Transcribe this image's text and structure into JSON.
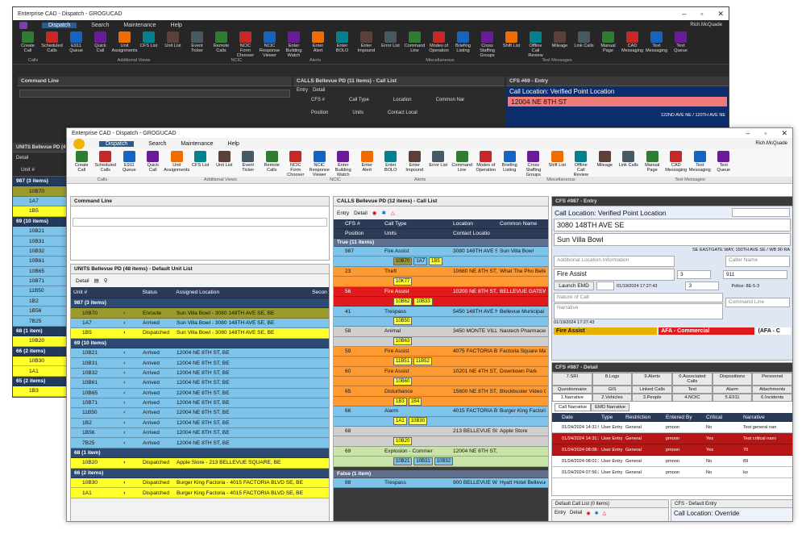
{
  "back_window": {
    "title": "Enterprise CAD - Dispatch - GROGUCAD",
    "user": "Rich.McQuade",
    "menu": [
      "Dispatch",
      "Search",
      "Maintenance",
      "Help"
    ],
    "ribbon": [
      "Create Call",
      "Scheduled Calls",
      "E911 Queue",
      "Quick Call",
      "Unit Assignments",
      "CFS List",
      "Unit List",
      "Event Ticker",
      "Remote Calls",
      "NCIC Form Chooser",
      "NCIC Response Viewer",
      "Enter Building Watch",
      "Enter Alert",
      "Enter BOLO",
      "Enter Impound",
      "Error List",
      "Command Line",
      "Modes of Operation",
      "Briefing Listing",
      "Cross Staffing Groups",
      "Shift List",
      "Offline Call Review",
      "Mileage",
      "Link Calls",
      "Manual Page",
      "CAD Messaging",
      "Text Messaging",
      "Text Queue"
    ],
    "groups": [
      "Calls",
      "Additional Views",
      "NCIC",
      "Alerts",
      "Miscellaneous",
      "Text Messages"
    ],
    "command_line": "Command Line",
    "calls_title": "CALLS Bellevue PD (11 items) - Call List",
    "calls_toolbar": [
      "Entry",
      "Detail"
    ],
    "calls_cols": [
      "CFS #",
      "Call Type",
      "Location",
      "Common Nar"
    ],
    "calls_cols2": [
      "Position",
      "Units",
      "Contact Local"
    ],
    "cfs_title": "CFS #69 - Entry",
    "call_location": "Call Location:  Verified Point Location",
    "address": "12004 NE 8TH ST",
    "cross": "122ND AVE NE / 120TH AVE NE",
    "units_title": "UNITS Bellevue PD (4",
    "units_toolbar": "Detail",
    "unit_col": "Unit #",
    "groups_list": [
      {
        "label": "987 (3 items)",
        "units": [
          {
            "id": "10B70",
            "c": "olive"
          },
          {
            "id": "1A7",
            "c": "blue"
          },
          {
            "id": "1B5",
            "c": "yellow"
          }
        ]
      },
      {
        "label": "69 (10 items)",
        "units": [
          {
            "id": "10B21",
            "c": "blue"
          },
          {
            "id": "10B31",
            "c": "blue"
          },
          {
            "id": "10B32",
            "c": "blue"
          },
          {
            "id": "10B61",
            "c": "blue"
          },
          {
            "id": "10B65",
            "c": "blue"
          },
          {
            "id": "10B71",
            "c": "blue"
          },
          {
            "id": "11B50",
            "c": "blue"
          },
          {
            "id": "1B2",
            "c": "blue"
          },
          {
            "id": "1B56",
            "c": "blue"
          },
          {
            "id": "7B25",
            "c": "blue"
          }
        ]
      },
      {
        "label": "68 (1 item)",
        "units": [
          {
            "id": "10B20",
            "c": "yellow"
          }
        ]
      },
      {
        "label": "66 (2 items)",
        "units": [
          {
            "id": "10B30",
            "c": "yellow"
          },
          {
            "id": "1A1",
            "c": "yellow"
          }
        ]
      },
      {
        "label": "65 (2 items)",
        "units": [
          {
            "id": "1B3",
            "c": "yellow"
          }
        ]
      }
    ]
  },
  "front_window": {
    "title": "Enterprise CAD - Dispatch - GROGUCAD",
    "user": "Rich.McQuade",
    "menu": [
      "Dispatch",
      "Search",
      "Maintenance",
      "Help"
    ],
    "command_line": "Command Line",
    "units_title": "UNITS Bellevue PD (48 items) - Default Unit List",
    "units_toolbar": "Detail",
    "units_cols": [
      "Unit #",
      "Status",
      "Assigned Location",
      "Secon"
    ],
    "units_groups": [
      {
        "label": "987 (3 items)",
        "rows": [
          {
            "unit": "10B70",
            "status": "Enroute",
            "loc": "Sun Villa Bowl - 3080 148TH AVE SE, BE",
            "c": "olive"
          },
          {
            "unit": "1A7",
            "status": "Arrived",
            "loc": "Sun Villa Bowl - 3080 148TH AVE SE, BE",
            "c": "blue"
          },
          {
            "unit": "1B5",
            "status": "Dispatched",
            "loc": "Sun Villa Bowl - 3080 148TH AVE SE, BE",
            "c": "yellow"
          }
        ]
      },
      {
        "label": "69 (10 items)",
        "rows": [
          {
            "unit": "10B21",
            "status": "Arrived",
            "loc": "12004 NE 8TH ST, BE",
            "c": "blue"
          },
          {
            "unit": "10B31",
            "status": "Arrived",
            "loc": "12004 NE 8TH ST, BE",
            "c": "blue"
          },
          {
            "unit": "10B32",
            "status": "Arrived",
            "loc": "12004 NE 8TH ST, BE",
            "c": "blue"
          },
          {
            "unit": "10B61",
            "status": "Arrived",
            "loc": "12004 NE 8TH ST, BE",
            "c": "blue"
          },
          {
            "unit": "10B65",
            "status": "Arrived",
            "loc": "12004 NE 8TH ST, BE",
            "c": "blue"
          },
          {
            "unit": "10B71",
            "status": "Arrived",
            "loc": "12004 NE 8TH ST, BE",
            "c": "blue"
          },
          {
            "unit": "11B50",
            "status": "Arrived",
            "loc": "12004 NE 8TH ST, BE",
            "c": "blue"
          },
          {
            "unit": "1B2",
            "status": "Arrived",
            "loc": "12004 NE 8TH ST, BE",
            "c": "blue"
          },
          {
            "unit": "1B56",
            "status": "Arrived",
            "loc": "12004 NE 8TH ST, BE",
            "c": "blue"
          },
          {
            "unit": "7B25",
            "status": "Arrived",
            "loc": "12004 NE 8TH ST, BE",
            "c": "blue"
          }
        ]
      },
      {
        "label": "68 (1 item)",
        "rows": [
          {
            "unit": "10B20",
            "status": "Dispatched",
            "loc": "Apple Store - 213 BELLEVUE SQUARE, BE",
            "c": "yellow"
          }
        ]
      },
      {
        "label": "66 (2 items)",
        "rows": [
          {
            "unit": "10B30",
            "status": "Dispatched",
            "loc": "Burger King Factoria - 4015 FACTORIA BLVD SE, BE",
            "c": "yellow"
          },
          {
            "unit": "1A1",
            "status": "Dispatched",
            "loc": "Burger King Factoria - 4015 FACTORIA BLVD SE, BE",
            "c": "yellow"
          }
        ]
      }
    ],
    "calls_title": "CALLS Bellevue PD (12 items) - Call List",
    "calls_toolbar": [
      "Entry",
      "Detail"
    ],
    "calls_cols": [
      "CFS #",
      "Call Type",
      "Location",
      "Common Name"
    ],
    "calls_cols2": [
      "Position",
      "Units",
      "Contact Locatio"
    ],
    "true_group": "True (11 items)",
    "false_group": "False (1 item)",
    "calls": [
      {
        "cfs": "987",
        "type": "Fire Assist",
        "loc": "3080 148TH AVE SE",
        "name": "Sun Villa Bowl",
        "c": "blue",
        "units": [
          [
            "10B70",
            "olive"
          ],
          [
            "1A7",
            "blue"
          ],
          [
            "1B5",
            "yellow"
          ]
        ]
      },
      {
        "cfs": "23",
        "type": "Theft",
        "loc": "10680 NE 8TH ST, BE",
        "name": "What The Pho Bellev",
        "c": "orange",
        "units": [
          [
            "10K77",
            "yellow"
          ]
        ]
      },
      {
        "cfs": "56",
        "type": "Fire Assist",
        "loc": "10200 NE 8TH ST, BE",
        "name": "BELLEVUE GATEWAY",
        "c": "red",
        "units": [
          [
            "10B62",
            "yellow"
          ],
          [
            "10B33",
            "yellow"
          ]
        ]
      },
      {
        "cfs": "41",
        "type": "Trespass",
        "loc": "5450 148TH AVE NE, BE",
        "name": "Bellevue Municipal C",
        "c": "blue",
        "units": [
          [
            "10B50",
            "yellow"
          ]
        ]
      },
      {
        "cfs": "58",
        "type": "Animal",
        "loc": "3450 MONTE VILLA PKWY",
        "name": "Nastech Pharmaceut",
        "c": "gray",
        "units": [
          [
            "10B63",
            "yellow"
          ]
        ]
      },
      {
        "cfs": "59",
        "type": "Fire Assist",
        "loc": "4075 FACTORIA BLVD SE",
        "name": "Factoria Square Mall",
        "c": "orange",
        "units": [
          [
            "11B51",
            "yellow"
          ],
          [
            "11B52",
            "yellow"
          ]
        ]
      },
      {
        "cfs": "60",
        "type": "Fire Assist",
        "loc": "10201 NE 4TH ST, BE",
        "name": "Downtown Park",
        "c": "orange",
        "units": [
          [
            "10B60",
            "yellow"
          ]
        ]
      },
      {
        "cfs": "65",
        "type": "Disturbance",
        "loc": "15600 NE 8TH ST, BE",
        "name": "Blockbuster Video C",
        "c": "orange",
        "units": [
          [
            "1B3",
            "yellow"
          ],
          [
            "1B4",
            "yellow"
          ]
        ]
      },
      {
        "cfs": "66",
        "type": "Alarm",
        "loc": "4015 FACTORIA BLVD",
        "name": "Burger King Factoria",
        "c": "blue",
        "units": [
          [
            "1A1",
            "yellow"
          ],
          [
            "10B30",
            "yellow"
          ]
        ]
      },
      {
        "cfs": "68",
        "type": "",
        "loc": "213 BELLEVUE SQUA",
        "name": "Apple Store",
        "c": "gray",
        "units": [
          [
            "10B20",
            "yellow"
          ]
        ]
      },
      {
        "cfs": "69",
        "type": "Explosion - Commer",
        "loc": "12004 NE 8TH ST, BE",
        "name": "",
        "c": "green",
        "units": [
          [
            "10B21",
            "blue"
          ],
          [
            "10B31",
            "blue"
          ],
          [
            "10B32",
            "blue"
          ]
        ]
      }
    ],
    "false_call": {
      "cfs": "88",
      "type": "Trespass",
      "loc": "900 BELLEVUE WAY N",
      "name": "Hyatt Hotel Bellevue"
    },
    "cfs_title": "CFS #987 - Entry",
    "call_location": "Call Location:  Verified Point Location",
    "address": "3080 148TH AVE SE",
    "common_name": "Sun Villa Bowl",
    "cross": "SE EASTGATE WAY, 150TH AVE SE / WB 90 RA",
    "add_loc_placeholder": "Additional Location Information",
    "caller_placeholder": "Caller Name",
    "call_type": "Fire Assist",
    "priority1": "3",
    "priority2": "3",
    "code": "911",
    "police": "Police: 8E-5-3",
    "launch_emd": "Launch EMD",
    "datetime": "01/19/2024 17:27:43",
    "nature_placeholder": "Nature of Call",
    "narrative_placeholder": "Narrative",
    "command_placeholder": "Command Line",
    "datetime2": "01/19/2024 17:27:43",
    "strip": [
      "Fire Assist",
      "AFA - Commercial",
      "(AFA - C"
    ],
    "detail_title": "CFS #987 - Detail",
    "tabs1": [
      "7.SRI",
      "8.Logs",
      "9.Alerts",
      "0.Associated Calls",
      "Dispositions",
      "Personnel"
    ],
    "tabs2": [
      "Questionnaire",
      "GIS",
      "Linked Calls",
      "Text",
      "Alarm",
      "Attachments"
    ],
    "tabs3": [
      "1.Narrative",
      "2.Vehicles",
      "3.People",
      "4.NOIC",
      "5.E911",
      "6.Incidents"
    ],
    "subtabs": [
      "Call Narrative",
      "EMD Narrative"
    ],
    "narr_cols": [
      "Date",
      "Type",
      "Restriction",
      "Entered By",
      "Critical",
      "Narrative"
    ],
    "narr_rows": [
      {
        "date": "01/24/2024 14:31:53",
        "type": "User Entry",
        "restr": "General",
        "by": "pmoon",
        "crit": "No",
        "text": "Test general narrative",
        "c": "white"
      },
      {
        "date": "01/24/2024 14:31:37",
        "type": "User Entry",
        "restr": "General",
        "by": "pmoon",
        "crit": "Yes",
        "text": "Test critical narrative ent",
        "c": "darkred"
      },
      {
        "date": "01/24/2024 08:08:15",
        "type": "User Entry",
        "restr": "General",
        "by": "pmoon",
        "crit": "Yes",
        "text": "70",
        "c": "darkred"
      },
      {
        "date": "01/24/2024 08:01:23",
        "type": "User Entry",
        "restr": "General",
        "by": "pmoon",
        "crit": "No",
        "text": "89",
        "c": "white"
      },
      {
        "date": "01/24/2024 07:56:32",
        "type": "User Entry",
        "restr": "General",
        "by": "pmoon",
        "crit": "No",
        "text": "ko",
        "c": "white"
      }
    ],
    "default_calls_title": "Default Call List (0 items)",
    "default_calls_toolbar": [
      "Entry",
      "Detail"
    ],
    "default_entry_title": "CFS - Default Entry",
    "override": "Call Location:  Override"
  },
  "colors": {
    "olive": "#9c9a2c",
    "blue": "#7ec3ea",
    "yellow": "#ffff2a",
    "orange": "#ff9a33",
    "red": "#e11b1b",
    "header": "#2d4a73"
  }
}
